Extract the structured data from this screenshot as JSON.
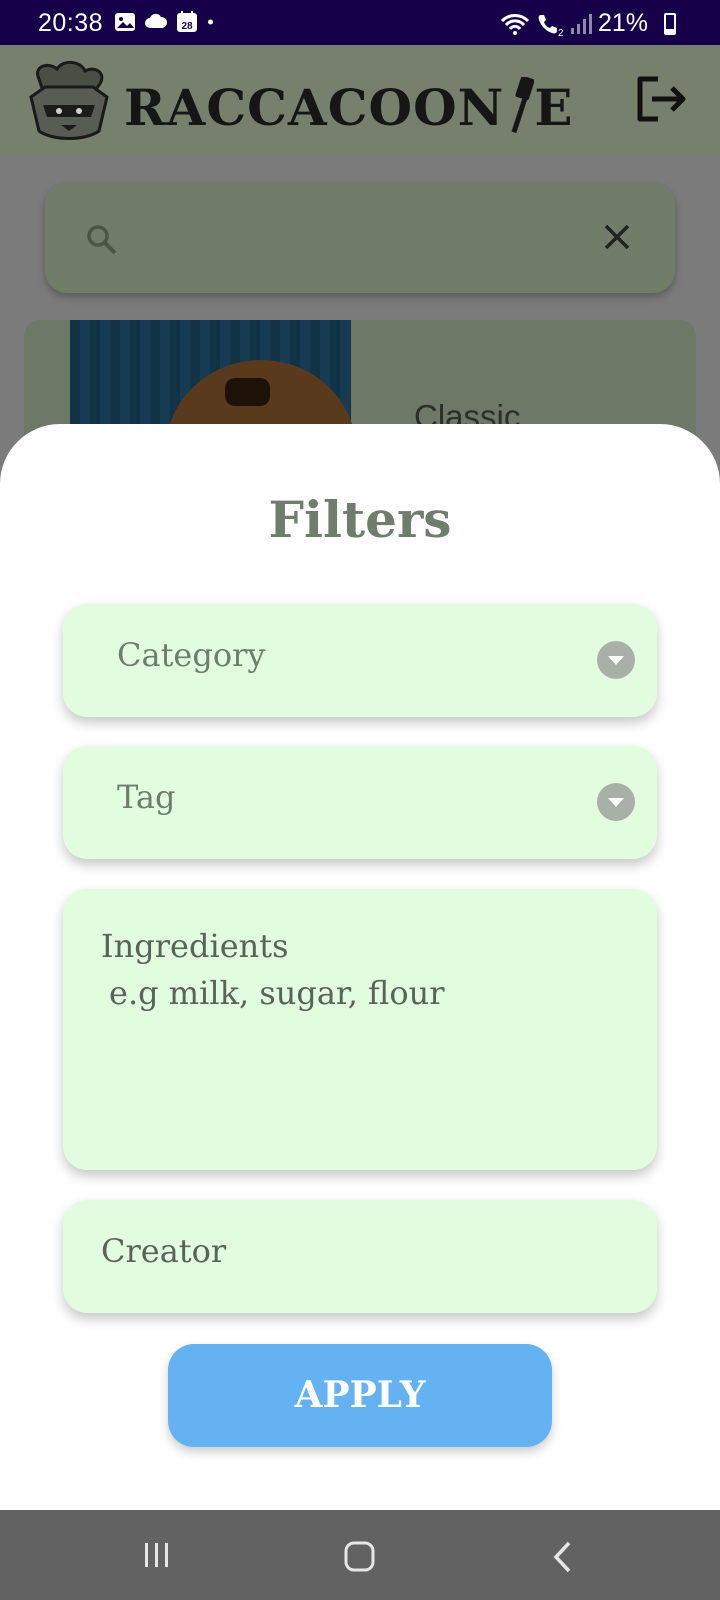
{
  "status_bar": {
    "time": "20:38",
    "calendar_day": "28",
    "battery": "21%",
    "notification_icons": [
      "image-icon",
      "cloud-icon",
      "calendar-icon",
      "dot-icon"
    ],
    "system_icons": [
      "wifi-icon",
      "call-icon",
      "signal-icon",
      "battery-icon"
    ]
  },
  "app_header": {
    "logo_text_left": "RACCACOON",
    "logo_text_right": "E",
    "logout_icon": "logout-icon"
  },
  "background": {
    "search_placeholder": "",
    "recipe_card_title": "Classic"
  },
  "filters_sheet": {
    "title": "Filters",
    "category": {
      "label": "Category"
    },
    "tag": {
      "label": "Tag"
    },
    "ingredients": {
      "label": "Ingredients",
      "placeholder": " e.g milk, sugar, flour"
    },
    "creator": {
      "label": "Creator"
    },
    "apply_label": "APPLY"
  },
  "colors": {
    "status_bar": "#17004a",
    "field_bg": "#e2fce0",
    "title_text": "#6e7d6c",
    "apply_button": "#64b2f2",
    "nav_bar": "#626262"
  },
  "nav_bar": {
    "icons": [
      "recents-icon",
      "home-icon",
      "back-icon"
    ]
  }
}
